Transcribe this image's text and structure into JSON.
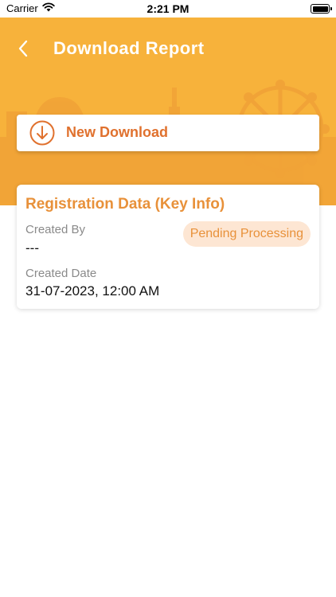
{
  "status_bar": {
    "carrier": "Carrier",
    "time": "2:21 PM"
  },
  "header": {
    "title": "Download Report",
    "background_color": "#f7b23b"
  },
  "new_download": {
    "label": "New Download",
    "icon": "download-circle-icon",
    "accent_color": "#e0712e"
  },
  "report": {
    "title": "Registration Data (Key Info)",
    "status": "Pending Processing",
    "created_by_label": "Created By",
    "created_by_value": "---",
    "created_date_label": "Created Date",
    "created_date_value": "31-07-2023, 12:00 AM"
  }
}
